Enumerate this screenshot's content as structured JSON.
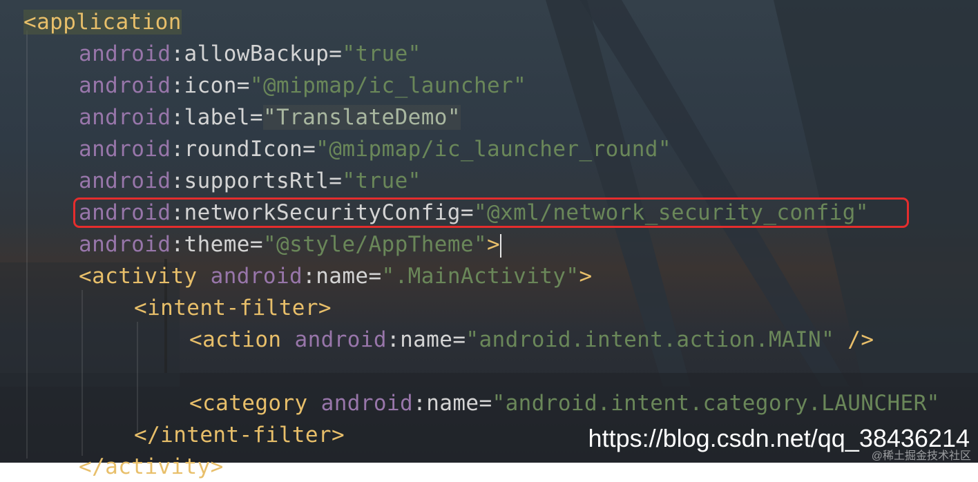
{
  "watermark": "https://blog.csdn.net/qq_38436214",
  "watermark_small": "@稀土掘金技术社区",
  "colors": {
    "tag": "#e8bf6a",
    "namespace": "#9876aa",
    "attribute": "#d4d4d4",
    "value": "#6a8759",
    "highlight_box": "#e52d2d"
  },
  "lines": [
    {
      "tag": "<application"
    },
    {
      "ns": "android",
      "colon": ":",
      "attr": "allowBackup",
      "eq": "=",
      "val": "\"true\""
    },
    {
      "ns": "android",
      "colon": ":",
      "attr": "icon",
      "eq": "=",
      "val": "\"@mipmap/ic_launcher\""
    },
    {
      "ns": "android",
      "colon": ":",
      "attr": "label",
      "eq": "=",
      "val": "\"TranslateDemo\""
    },
    {
      "ns": "android",
      "colon": ":",
      "attr": "roundIcon",
      "eq": "=",
      "val": "\"@mipmap/ic_launcher_round\""
    },
    {
      "ns": "android",
      "colon": ":",
      "attr": "supportsRtl",
      "eq": "=",
      "val": "\"true\""
    },
    {
      "ns": "android",
      "colon": ":",
      "attr": "networkSecurityConfig",
      "eq": "=",
      "val": "\"@xml/network_security_config\""
    },
    {
      "ns": "android",
      "colon": ":",
      "attr": "theme",
      "eq": "=",
      "val": "\"@style/AppTheme\"",
      "end": ">"
    },
    {
      "tag": "<activity",
      "ns": "android",
      "colon": ":",
      "attr": "name",
      "eq": "=",
      "val": "\".MainActivity\"",
      "end": ">"
    },
    {
      "tag": "<intent-filter>"
    },
    {
      "tag": "<action",
      "ns": "android",
      "colon": ":",
      "attr": "name",
      "eq": "=",
      "val": "\"android.intent.action.MAIN\"",
      "end": " />"
    },
    {
      "tag": "<category",
      "ns": "android",
      "colon": ":",
      "attr": "name",
      "eq": "=",
      "val": "\"android.intent.category.LAUNCHER\""
    },
    {
      "tag": "</intent-filter>"
    },
    {
      "tag": "</activity>"
    }
  ]
}
